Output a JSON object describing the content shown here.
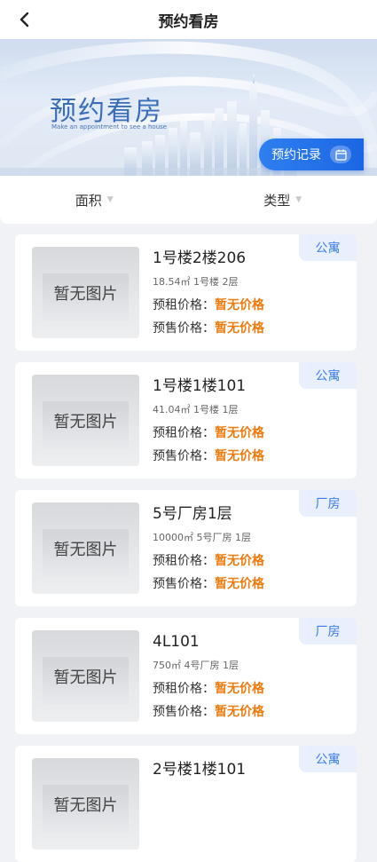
{
  "navbar": {
    "title": "预约看房"
  },
  "banner": {
    "title": "预约看房",
    "subtitle": "Make an appointment to see a house",
    "record_button": "预约记录"
  },
  "filters": [
    {
      "label": "面积"
    },
    {
      "label": "类型"
    }
  ],
  "price_labels": {
    "rent": "预租价格：",
    "sale": "预售价格："
  },
  "listings": [
    {
      "name": "1号楼2楼206",
      "meta": "18.54㎡ 1号楼 2层",
      "rent": "暂无价格",
      "sale": "暂无价格",
      "tag": "公寓",
      "image_placeholder": "暂无图片"
    },
    {
      "name": "1号楼1楼101",
      "meta": "41.04㎡ 1号楼 1层",
      "rent": "暂无价格",
      "sale": "暂无价格",
      "tag": "公寓",
      "image_placeholder": "暂无图片"
    },
    {
      "name": "5号厂房1层",
      "meta": "10000㎡ 5号厂房 1层",
      "rent": "暂无价格",
      "sale": "暂无价格",
      "tag": "厂房",
      "image_placeholder": "暂无图片"
    },
    {
      "name": "4L101",
      "meta": "750㎡ 4号厂房 1层",
      "rent": "暂无价格",
      "sale": "暂无价格",
      "tag": "厂房",
      "image_placeholder": "暂无图片"
    },
    {
      "name": "2号楼1楼101",
      "meta": "",
      "rent": "",
      "sale": "",
      "tag": "公寓",
      "image_placeholder": "暂无图片"
    }
  ]
}
